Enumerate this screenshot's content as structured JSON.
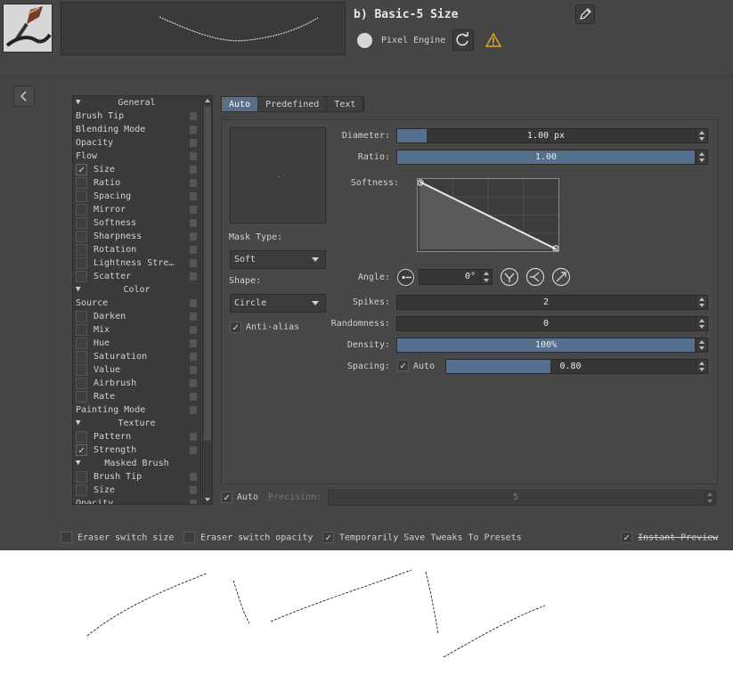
{
  "preset": {
    "name": "b) Basic-5 Size",
    "engine_label": "Pixel Engine"
  },
  "icons": {
    "thumb": "brush-stroke-thumbnail",
    "edit": "pencil-edit-icon",
    "reload": "reload-icon",
    "warning": "warning-icon",
    "collapse": "chevron-left-icon"
  },
  "option_list": [
    {
      "type": "cat",
      "label": "General"
    },
    {
      "type": "item",
      "label": "Brush Tip",
      "lock": true
    },
    {
      "type": "item",
      "label": "Blending Mode",
      "lock": true
    },
    {
      "type": "item",
      "label": "Opacity",
      "lock": true
    },
    {
      "type": "item",
      "label": "Flow",
      "lock": true
    },
    {
      "type": "sub",
      "label": "Size",
      "checked": true,
      "lock": true
    },
    {
      "type": "sub",
      "label": "Ratio",
      "checked": false,
      "lock": true
    },
    {
      "type": "sub",
      "label": "Spacing",
      "checked": false,
      "lock": true
    },
    {
      "type": "sub",
      "label": "Mirror",
      "checked": false,
      "lock": true
    },
    {
      "type": "sub",
      "label": "Softness",
      "checked": false,
      "lock": true
    },
    {
      "type": "sub",
      "label": "Sharpness",
      "checked": false,
      "lock": true
    },
    {
      "type": "sub",
      "label": "Rotation",
      "checked": false,
      "lock": true
    },
    {
      "type": "sub",
      "label": "Lightness Stre…",
      "checked": false,
      "lock": true
    },
    {
      "type": "sub",
      "label": "Scatter",
      "checked": false,
      "lock": true
    },
    {
      "type": "cat",
      "label": "Color"
    },
    {
      "type": "item",
      "label": "Source",
      "lock": true
    },
    {
      "type": "sub",
      "label": "Darken",
      "checked": false,
      "lock": true
    },
    {
      "type": "sub",
      "label": "Mix",
      "checked": false,
      "lock": true
    },
    {
      "type": "sub",
      "label": "Hue",
      "checked": false,
      "lock": true
    },
    {
      "type": "sub",
      "label": "Saturation",
      "checked": false,
      "lock": true
    },
    {
      "type": "sub",
      "label": "Value",
      "checked": false,
      "lock": true
    },
    {
      "type": "sub",
      "label": "Airbrush",
      "checked": false,
      "lock": true
    },
    {
      "type": "sub",
      "label": "Rate",
      "checked": false,
      "lock": true
    },
    {
      "type": "item",
      "label": "Painting Mode",
      "lock": true
    },
    {
      "type": "cat",
      "label": "Texture"
    },
    {
      "type": "sub",
      "label": "Pattern",
      "checked": false,
      "lock": true
    },
    {
      "type": "sub",
      "label": "Strength",
      "checked": true,
      "lock": true
    },
    {
      "type": "cat",
      "label": "Masked Brush"
    },
    {
      "type": "sub",
      "label": "Brush Tip",
      "checked": false,
      "lock": true
    },
    {
      "type": "sub",
      "label": "Size",
      "checked": false,
      "lock": true
    },
    {
      "type": "item",
      "label": "Opacity",
      "lock": true
    }
  ],
  "tabs": [
    "Auto",
    "Predefined",
    "Text"
  ],
  "active_tab": 0,
  "tip": {
    "mask_type_label": "Mask Type:",
    "mask_type_value": "Soft",
    "shape_label": "Shape:",
    "shape_value": "Circle",
    "antialias_label": "Anti-alias",
    "antialias_checked": "✓",
    "diameter_label": "Diameter:",
    "diameter_value": "1.00 px",
    "diameter_fill": 0.1,
    "ratio_label": "Ratio:",
    "ratio_value": "1.00",
    "ratio_fill": 1.0,
    "softness_label": "Softness:",
    "angle_label": "Angle:",
    "angle_value": "0°",
    "spikes_label": "Spikes:",
    "spikes_value": "2",
    "spikes_fill": 0.0,
    "randomness_label": "Randomness:",
    "randomness_value": "0",
    "randomness_fill": 0.0,
    "density_label": "Density:",
    "density_value": "100%",
    "density_fill": 1.0,
    "spacing_label": "Spacing:",
    "spacing_auto_label": "Auto",
    "spacing_auto_checked": "✓",
    "spacing_value": "0.80",
    "spacing_fill": 0.42
  },
  "precision": {
    "auto_label": "Auto",
    "auto_checked": "✓",
    "label": "Precision:",
    "value": "5"
  },
  "bottom": {
    "eraser_size": "Eraser switch size",
    "eraser_opacity": "Eraser switch opacity",
    "temp_save": "Temporarily Save Tweaks To Presets",
    "temp_save_checked": "✓",
    "instant_preview": "Instant Preview",
    "instant_preview_checked": "✓"
  }
}
